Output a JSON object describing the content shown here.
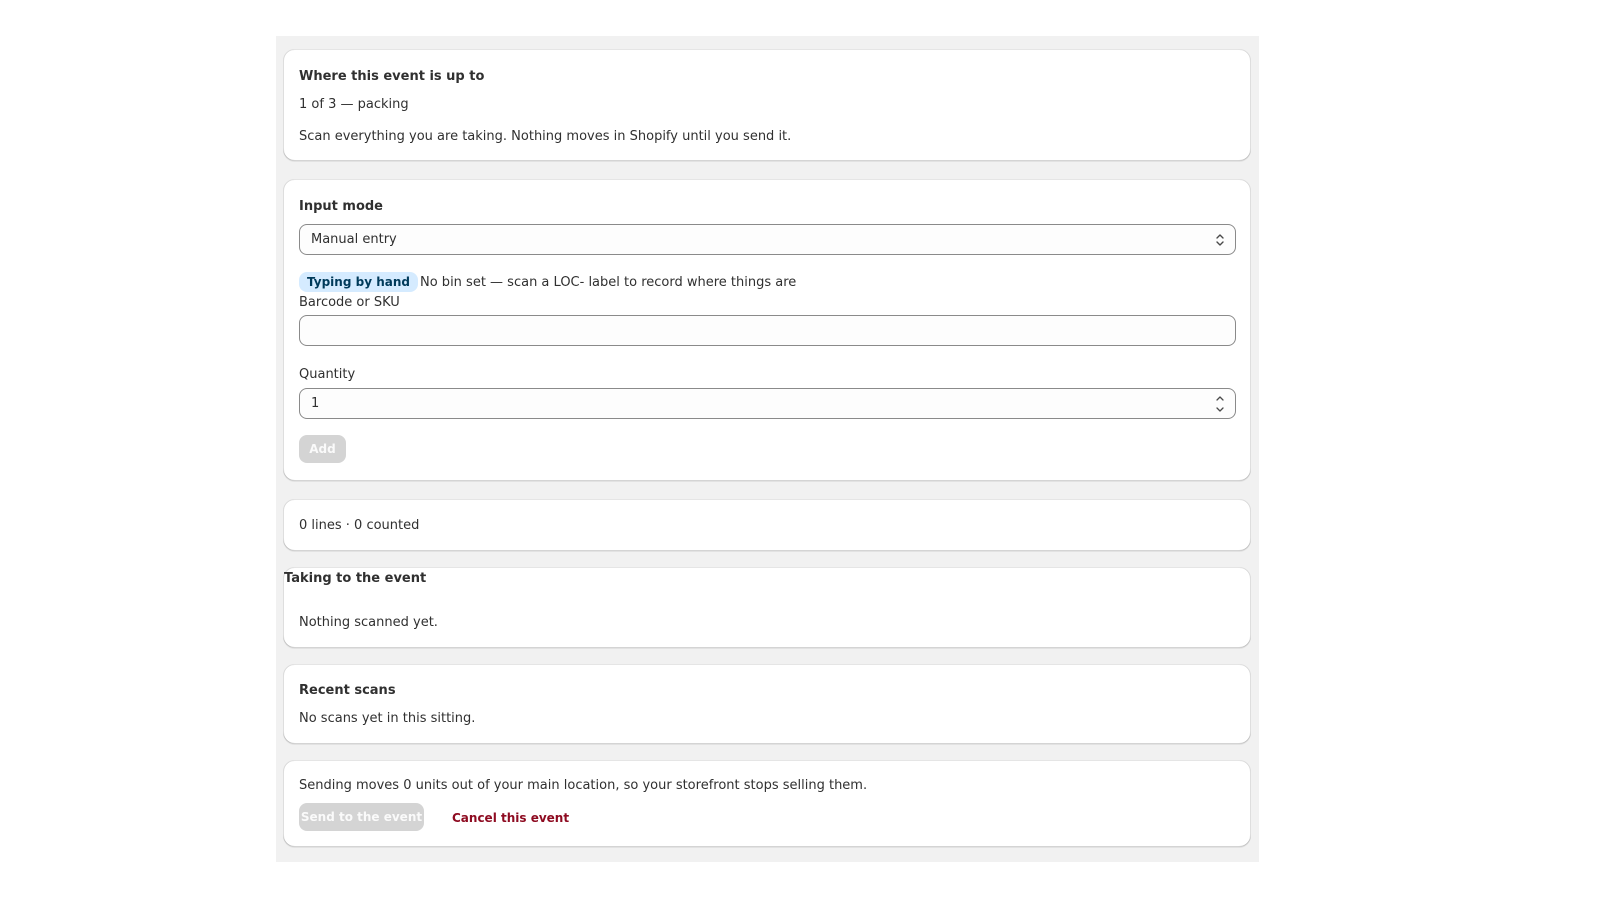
{
  "status_card": {
    "heading": "Where this event is up to",
    "step": "1 of 3 — packing",
    "description": "Scan everything you are taking. Nothing moves in Shopify until you send it."
  },
  "input_card": {
    "mode_label": "Input mode",
    "mode_value": "Manual entry",
    "mode_badge": "Typing by hand",
    "bin_status": "No bin set — scan a LOC- label to record where things are",
    "barcode_label": "Barcode or SKU",
    "barcode_value": "",
    "quantity_label": "Quantity",
    "quantity_value": "1",
    "add_button": "Add"
  },
  "summary": {
    "text": "0 lines · 0 counted"
  },
  "taking": {
    "heading": "Taking to the event",
    "empty": "Nothing scanned yet."
  },
  "recent": {
    "heading": "Recent scans",
    "empty": "No scans yet in this sitting."
  },
  "send_card": {
    "note": "Sending moves 0 units out of your main location, so your storefront stops selling them.",
    "send_button": "Send to the event",
    "cancel_link": "Cancel this event"
  },
  "colors": {
    "page_bg": "#f1f1f1",
    "badge_bg": "#d5ebff",
    "critical": "#8e0b21",
    "disabled": "#d4d4d4"
  }
}
